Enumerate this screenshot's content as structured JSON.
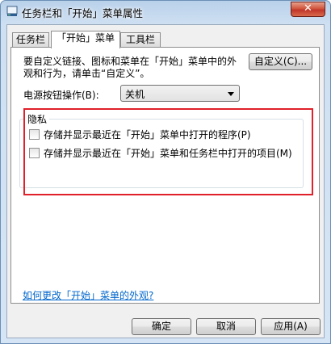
{
  "window": {
    "title": "任务栏和「开始」菜单属性",
    "close": "✕"
  },
  "tabs": [
    "任务栏",
    "「开始」菜单",
    "工具栏"
  ],
  "start_menu": {
    "description": "要自定义链接、图标和菜单在「开始」菜单中的外观和行为，请单击“自定义”。",
    "customize_button": "自定义(C)...",
    "power_label": "电源按钮操作(B):",
    "power_value": "关机"
  },
  "privacy": {
    "title": "隐私",
    "option1": "存储并显示最近在「开始」菜单中打开的程序(P)",
    "option2": "存储并显示最近在「开始」菜单和任务栏中打开的项目(M)"
  },
  "link": "如何更改「开始」菜单的外观?",
  "footer": {
    "ok": "确定",
    "cancel": "取消",
    "apply": "应用(A)"
  }
}
